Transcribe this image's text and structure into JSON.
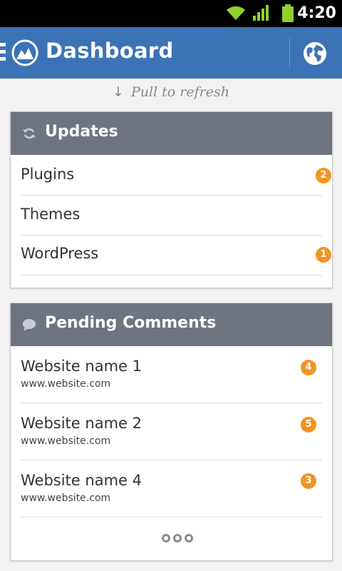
{
  "status_bar": {
    "time": "4:20",
    "icons": [
      "wifi-icon",
      "signal-icon",
      "battery-icon"
    ]
  },
  "action_bar": {
    "title": "Dashboard",
    "logo_icon": "app-logo-icon",
    "right_icon": "globe-icon"
  },
  "pull_to_refresh": {
    "arrow": "↓",
    "text": "Pull to refresh"
  },
  "updates": {
    "title": "Updates",
    "icon": "refresh-icon",
    "items": [
      {
        "label": "Plugins",
        "badge": "2"
      },
      {
        "label": "Themes",
        "badge": ""
      },
      {
        "label": "WordPress",
        "badge": "1"
      }
    ]
  },
  "pending_comments": {
    "title": "Pending Comments",
    "icon": "comment-bubble-icon",
    "items": [
      {
        "name": "Website name 1",
        "url": "www.website.com",
        "badge": "4"
      },
      {
        "name": "Website name 2",
        "url": "www.website.com",
        "badge": "5"
      },
      {
        "name": "Website name 4",
        "url": "www.website.com",
        "badge": "3"
      }
    ],
    "pager_dots": 3
  },
  "colors": {
    "action_bar": "#3b73b6",
    "card_header": "#6e7580",
    "badge": "#f29423",
    "background": "#f2f2f2"
  }
}
